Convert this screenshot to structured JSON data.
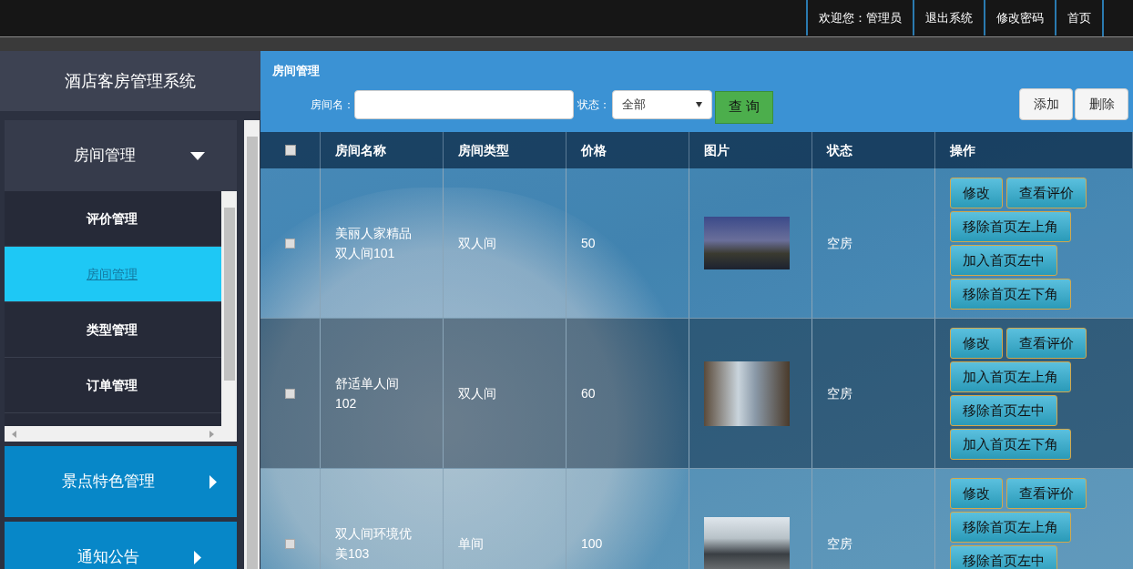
{
  "top_nav": [
    {
      "label": "欢迎您：管理员"
    },
    {
      "label": "退出系统"
    },
    {
      "label": "修改密码"
    },
    {
      "label": "首页"
    }
  ],
  "sidebar": {
    "title": "酒店客房管理系统",
    "groups": [
      {
        "label": "房间管理",
        "expanded": true,
        "children": [
          {
            "label": "评价管理",
            "selected": false
          },
          {
            "label": "房间管理",
            "selected": true
          },
          {
            "label": "类型管理",
            "selected": false
          },
          {
            "label": "订单管理",
            "selected": false
          }
        ]
      },
      {
        "label": "景点特色管理",
        "expanded": false
      },
      {
        "label": "通知公告",
        "expanded": false
      }
    ]
  },
  "panel": {
    "title": "房间管理",
    "search": {
      "name_label": "房间名：",
      "status_label": "状态：",
      "status_value": "全部",
      "search_button": "查 询"
    },
    "buttons": [
      "添加",
      "删除"
    ]
  },
  "table": {
    "columns": [
      "房间名称",
      "房间类型",
      "价格",
      "图片",
      "状态",
      "操作"
    ],
    "header_checked": false,
    "rows": [
      {
        "checked": false,
        "name": "美丽人家精品双人间101",
        "type": "双人间",
        "price": "50",
        "status": "空房",
        "actions": [
          "修改",
          "查看评价",
          "移除首页左上角",
          "加入首页左中",
          "移除首页左下角"
        ]
      },
      {
        "checked": false,
        "name": "舒适单人间102",
        "type": "双人间",
        "price": "60",
        "status": "空房",
        "actions": [
          "修改",
          "查看评价",
          "加入首页左上角",
          "移除首页左中",
          "加入首页左下角"
        ]
      },
      {
        "checked": false,
        "name": "双人间环境优美103",
        "type": "单间",
        "price": "100",
        "status": "空房",
        "actions": [
          "修改",
          "查看评价",
          "移除首页左上角",
          "移除首页左中"
        ]
      }
    ]
  }
}
